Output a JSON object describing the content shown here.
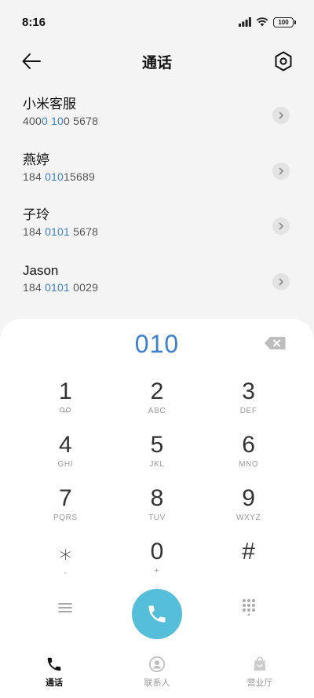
{
  "status_bar": {
    "time": "8:16",
    "battery": "100"
  },
  "header": {
    "title": "通话"
  },
  "contacts": [
    {
      "name": "小米客服",
      "number_parts": [
        "400",
        "0 10",
        "0 5678"
      ]
    },
    {
      "name": "燕婷",
      "number_parts": [
        "184 ",
        "010",
        "15689"
      ]
    },
    {
      "name": "子玲",
      "number_parts": [
        "184 ",
        "0101",
        " 5678"
      ]
    },
    {
      "name": "Jason",
      "number_parts": [
        "184 ",
        "0101",
        " 0029"
      ]
    }
  ],
  "dialpad": {
    "input": "010",
    "keys": [
      {
        "digit": "1",
        "sub": ""
      },
      {
        "digit": "2",
        "sub": "ABC"
      },
      {
        "digit": "3",
        "sub": "DEF"
      },
      {
        "digit": "4",
        "sub": "GHI"
      },
      {
        "digit": "5",
        "sub": "JKL"
      },
      {
        "digit": "6",
        "sub": "MNO"
      },
      {
        "digit": "7",
        "sub": "PQRS"
      },
      {
        "digit": "8",
        "sub": "TUV"
      },
      {
        "digit": "9",
        "sub": "WXYZ"
      },
      {
        "digit": "⁎",
        "sub": ","
      },
      {
        "digit": "0",
        "sub": "+"
      },
      {
        "digit": "#",
        "sub": ""
      }
    ]
  },
  "tabs": [
    {
      "label": "通话",
      "icon": "phone-icon",
      "active": true
    },
    {
      "label": "联系人",
      "icon": "person-icon",
      "active": false
    },
    {
      "label": "营业厅",
      "icon": "bag-icon",
      "active": false
    }
  ],
  "colors": {
    "accent": "#3f7fd0",
    "call_button": "#55bfd9"
  }
}
